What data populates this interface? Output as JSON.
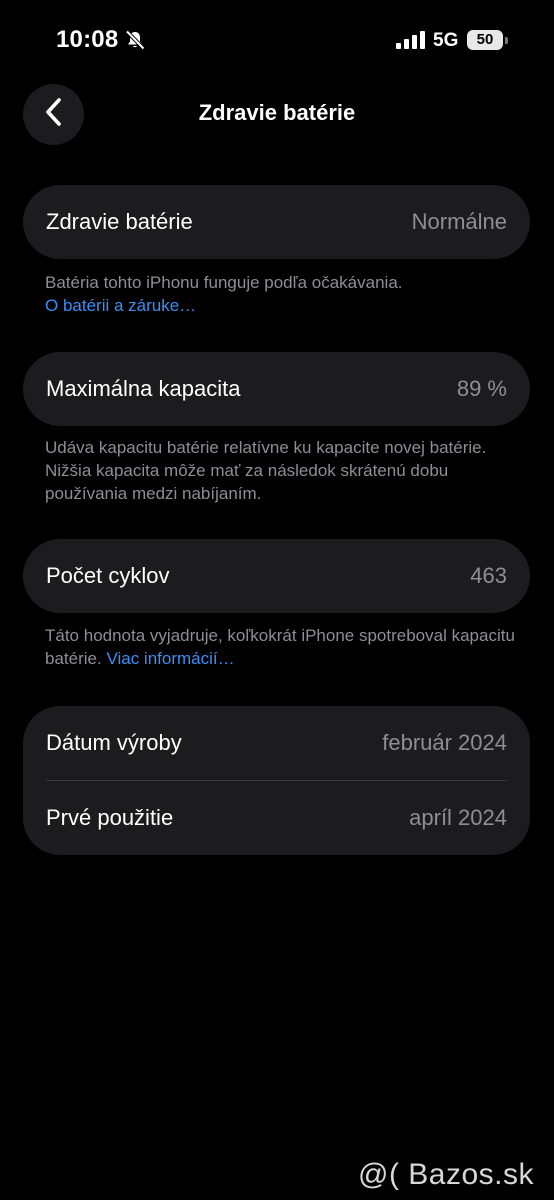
{
  "status_bar": {
    "time": "10:08",
    "network": "5G",
    "battery_level": "50",
    "icons": [
      "bell-slash-icon",
      "signal-icon"
    ]
  },
  "nav": {
    "back_icon": "chevron-left-icon",
    "title": "Zdravie batérie"
  },
  "health": {
    "label": "Zdravie batérie",
    "value": "Normálne",
    "note": "Batéria tohto iPhonu funguje podľa očakávania.",
    "link": "O batérii a záruke…"
  },
  "capacity": {
    "label": "Maximálna kapacita",
    "value": "89 %",
    "note": "Udáva kapacitu batérie relatívne ku kapacite novej batérie. Nižšia kapacita môže mať za následok skrátenú dobu používania medzi nabíjaním."
  },
  "cycles": {
    "label": "Počet cyklov",
    "value": "463",
    "note": "Táto hodnota vyjadruje, koľkokrát iPhone spotreboval kapacitu batérie.",
    "link": "Viac informácií…"
  },
  "dates": {
    "manufacture_label": "Dátum výroby",
    "manufacture_value": "február 2024",
    "first_use_label": "Prvé použitie",
    "first_use_value": "apríl 2024"
  },
  "watermark": "@( Bazos.sk",
  "colors": {
    "background": "#000000",
    "card": "#1c1c1e",
    "secondary_text": "#8e8e93",
    "link": "#3a8ff5"
  }
}
